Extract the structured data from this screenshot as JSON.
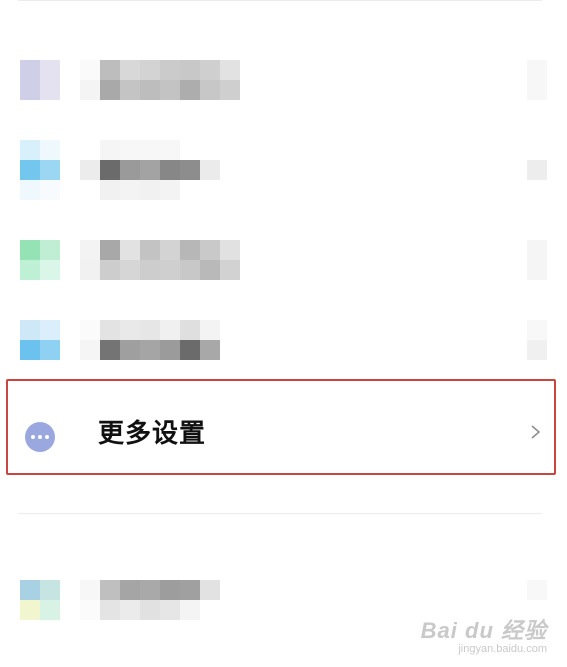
{
  "more_settings": {
    "label": "更多设置",
    "icon": "more-dots-icon",
    "chevron": "chevron-right-icon",
    "highlight_color": "#c9453f"
  },
  "watermark": {
    "logo": "Bai du 经验",
    "url": "jingyan.baidu.com"
  }
}
